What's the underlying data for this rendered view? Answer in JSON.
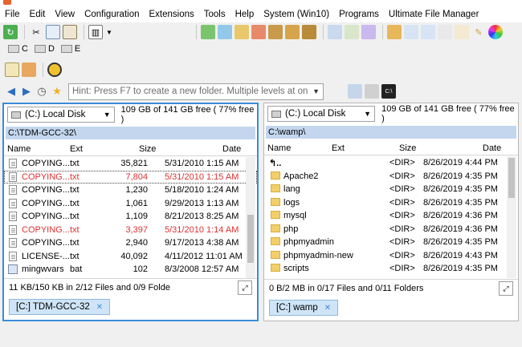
{
  "menu": [
    "File",
    "Edit",
    "View",
    "Configuration",
    "Extensions",
    "Tools",
    "Help",
    "System (Win10)",
    "Programs",
    "Ultimate File Manager"
  ],
  "drives": [
    {
      "letter": "C"
    },
    {
      "letter": "D"
    },
    {
      "letter": "E"
    }
  ],
  "command_line": {
    "placeholder": "Hint: Press F7 to create a new folder. Multiple levels at on"
  },
  "left": {
    "drive": "(C:) Local Disk",
    "free": "109 GB of 141 GB free ( 77% free )",
    "path": "C:\\TDM-GCC-32\\",
    "headers": {
      "name": "Name",
      "ext": "Ext",
      "size": "Size",
      "date": "Date"
    },
    "rows": [
      {
        "name": "COPYING...",
        "ext": "txt",
        "size": "35,821",
        "date": "5/31/2010 1:15 AM"
      },
      {
        "name": "COPYING...",
        "ext": "txt",
        "size": "7,804",
        "date": "5/31/2010 1:15 AM"
      },
      {
        "name": "COPYING...",
        "ext": "txt",
        "size": "1,230",
        "date": "5/18/2010 1:24 AM"
      },
      {
        "name": "COPYING...",
        "ext": "txt",
        "size": "1,061",
        "date": "9/29/2013 1:13 AM"
      },
      {
        "name": "COPYING...",
        "ext": "txt",
        "size": "1,109",
        "date": "8/21/2013 8:25 AM"
      },
      {
        "name": "COPYING...",
        "ext": "txt",
        "size": "3,397",
        "date": "5/31/2010 1:14 AM"
      },
      {
        "name": "COPYING...",
        "ext": "txt",
        "size": "2,940",
        "date": "9/17/2013 4:38 AM"
      },
      {
        "name": "LICENSE-...",
        "ext": "txt",
        "size": "40,092",
        "date": "4/11/2012 11:01 AM"
      },
      {
        "name": "mingwvars",
        "ext": "bat",
        "size": "102",
        "date": "8/3/2008 12:57 AM"
      }
    ],
    "status": "11 KB/150 KB in 2/12 Files and 0/9 Folde",
    "tab": "[C:] TDM-GCC-32"
  },
  "right": {
    "drive": "(C:) Local Disk",
    "free": "109 GB of 141 GB free ( 77% free )",
    "path": "C:\\wamp\\",
    "headers": {
      "name": "Name",
      "ext": "Ext",
      "size": "Size",
      "date": "Date"
    },
    "rows": [
      {
        "name": "",
        "ext": "",
        "size": "<DIR>",
        "date": "8/26/2019 4:44 PM"
      },
      {
        "name": "Apache2",
        "ext": "",
        "size": "<DIR>",
        "date": "8/26/2019 4:35 PM"
      },
      {
        "name": "lang",
        "ext": "",
        "size": "<DIR>",
        "date": "8/26/2019 4:35 PM"
      },
      {
        "name": "logs",
        "ext": "",
        "size": "<DIR>",
        "date": "8/26/2019 4:35 PM"
      },
      {
        "name": "mysql",
        "ext": "",
        "size": "<DIR>",
        "date": "8/26/2019 4:36 PM"
      },
      {
        "name": "php",
        "ext": "",
        "size": "<DIR>",
        "date": "8/26/2019 4:36 PM"
      },
      {
        "name": "phpmyadmin",
        "ext": "",
        "size": "<DIR>",
        "date": "8/26/2019 4:35 PM"
      },
      {
        "name": "phpmyadmin-new",
        "ext": "",
        "size": "<DIR>",
        "date": "8/26/2019 4:43 PM"
      },
      {
        "name": "scripts",
        "ext": "",
        "size": "<DIR>",
        "date": "8/26/2019 4:35 PM"
      }
    ],
    "status": "0 B/2 MB in 0/17 Files and 0/11 Folders",
    "tab": "[C:] wamp"
  }
}
